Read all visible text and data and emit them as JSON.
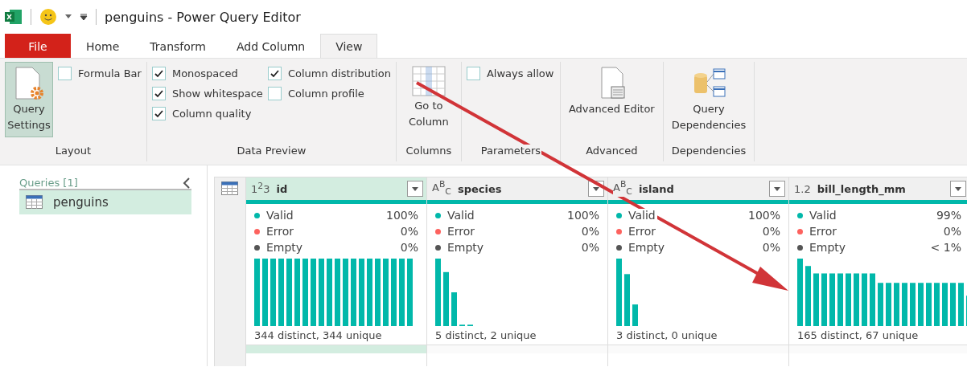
{
  "window": {
    "title": "penguins - Power Query Editor"
  },
  "tabs": [
    {
      "label": "File",
      "kind": "file",
      "selected": false
    },
    {
      "label": "Home",
      "kind": "tab",
      "selected": false
    },
    {
      "label": "Transform",
      "kind": "tab",
      "selected": false
    },
    {
      "label": "Add Column",
      "kind": "tab",
      "selected": false
    },
    {
      "label": "View",
      "kind": "tab",
      "selected": true
    }
  ],
  "ribbon": {
    "layout": {
      "label": "Layout",
      "query_settings": {
        "label": "Query Settings",
        "selected": true
      },
      "formula_bar": {
        "label": "Formula Bar",
        "checked": false
      }
    },
    "data_preview": {
      "label": "Data Preview",
      "options": [
        {
          "label": "Monospaced",
          "checked": true
        },
        {
          "label": "Show whitespace",
          "checked": true
        },
        {
          "label": "Column quality",
          "checked": true
        },
        {
          "label": "Column distribution",
          "checked": true
        },
        {
          "label": "Column profile",
          "checked": false
        }
      ]
    },
    "columns": {
      "label": "Columns",
      "button": "Go to Column"
    },
    "parameters": {
      "label": "Parameters",
      "always_allow": {
        "label": "Always allow",
        "checked": false
      }
    },
    "advanced": {
      "label": "Advanced",
      "button": "Advanced Editor"
    },
    "dependencies": {
      "label": "Dependencies",
      "button": "Query Dependencies"
    }
  },
  "queries": {
    "title": "Queries [1]",
    "items": [
      {
        "name": "penguins",
        "selected": true
      }
    ]
  },
  "table": {
    "columns": [
      {
        "type": "1$^{2}$3",
        "name": "id",
        "selected": true,
        "level": 1,
        "stats": [
          {
            "label": "Valid",
            "value": "100%",
            "color": "#01b8aa"
          },
          {
            "label": "Error",
            "value": "0%",
            "color": "#fd625e"
          },
          {
            "label": "Empty",
            "value": "0%",
            "color": "#555555"
          }
        ],
        "summary": "344 distinct, 344 unique"
      },
      {
        "type": "A$^{B}$$_{C}$",
        "name": "species",
        "selected": false,
        "level": 1,
        "stats": [
          {
            "label": "Valid",
            "value": "100%",
            "color": "#01b8aa"
          },
          {
            "label": "Error",
            "value": "0%",
            "color": "#fd625e"
          },
          {
            "label": "Empty",
            "value": "0%",
            "color": "#555555"
          }
        ],
        "summary": "5 distinct, 2 unique"
      },
      {
        "type": "A$^{B}$$_{C}$",
        "name": "island",
        "selected": false,
        "level": 1,
        "stats": [
          {
            "label": "Valid",
            "value": "100%",
            "color": "#01b8aa"
          },
          {
            "label": "Error",
            "value": "0%",
            "color": "#fd625e"
          },
          {
            "label": "Empty",
            "value": "0%",
            "color": "#555555"
          }
        ],
        "summary": "3 distinct, 0 unique"
      },
      {
        "type": "1.2",
        "name": "bill_length_mm",
        "selected": false,
        "level": 0.99,
        "stats": [
          {
            "label": "Valid",
            "value": "99%",
            "color": "#01b8aa"
          },
          {
            "label": "Error",
            "value": "0%",
            "color": "#fd625e"
          },
          {
            "label": "Empty",
            "value": "< 1%",
            "color": "#555555"
          }
        ],
        "summary": "165 distinct, 67 unique"
      }
    ]
  }
}
